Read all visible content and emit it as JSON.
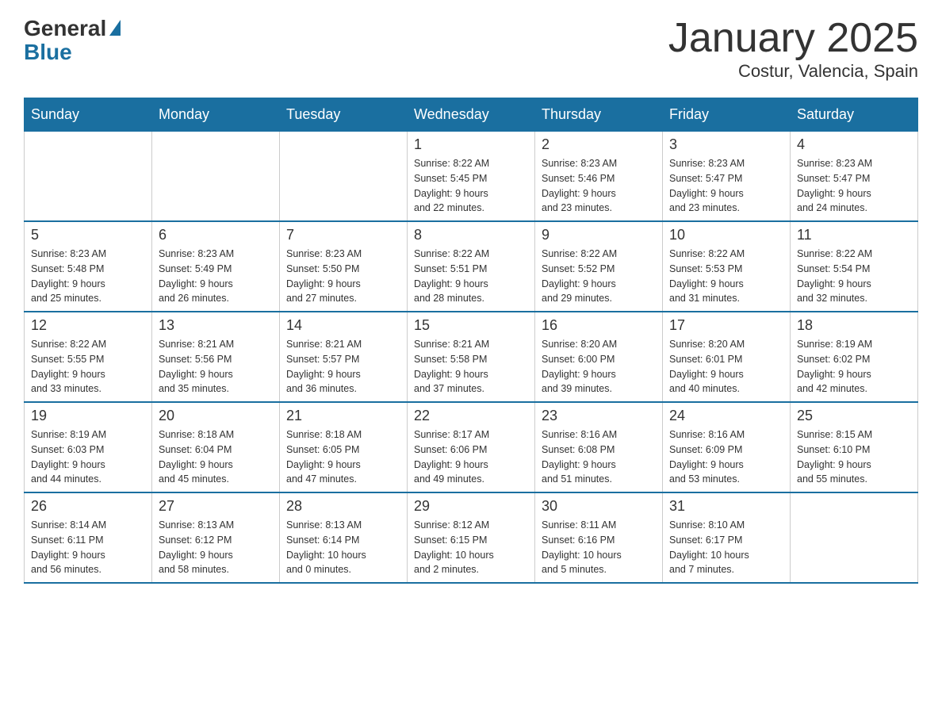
{
  "logo": {
    "general": "General",
    "blue": "Blue"
  },
  "title": "January 2025",
  "subtitle": "Costur, Valencia, Spain",
  "weekdays": [
    "Sunday",
    "Monday",
    "Tuesday",
    "Wednesday",
    "Thursday",
    "Friday",
    "Saturday"
  ],
  "weeks": [
    [
      {
        "day": "",
        "info": ""
      },
      {
        "day": "",
        "info": ""
      },
      {
        "day": "",
        "info": ""
      },
      {
        "day": "1",
        "info": "Sunrise: 8:22 AM\nSunset: 5:45 PM\nDaylight: 9 hours\nand 22 minutes."
      },
      {
        "day": "2",
        "info": "Sunrise: 8:23 AM\nSunset: 5:46 PM\nDaylight: 9 hours\nand 23 minutes."
      },
      {
        "day": "3",
        "info": "Sunrise: 8:23 AM\nSunset: 5:47 PM\nDaylight: 9 hours\nand 23 minutes."
      },
      {
        "day": "4",
        "info": "Sunrise: 8:23 AM\nSunset: 5:47 PM\nDaylight: 9 hours\nand 24 minutes."
      }
    ],
    [
      {
        "day": "5",
        "info": "Sunrise: 8:23 AM\nSunset: 5:48 PM\nDaylight: 9 hours\nand 25 minutes."
      },
      {
        "day": "6",
        "info": "Sunrise: 8:23 AM\nSunset: 5:49 PM\nDaylight: 9 hours\nand 26 minutes."
      },
      {
        "day": "7",
        "info": "Sunrise: 8:23 AM\nSunset: 5:50 PM\nDaylight: 9 hours\nand 27 minutes."
      },
      {
        "day": "8",
        "info": "Sunrise: 8:22 AM\nSunset: 5:51 PM\nDaylight: 9 hours\nand 28 minutes."
      },
      {
        "day": "9",
        "info": "Sunrise: 8:22 AM\nSunset: 5:52 PM\nDaylight: 9 hours\nand 29 minutes."
      },
      {
        "day": "10",
        "info": "Sunrise: 8:22 AM\nSunset: 5:53 PM\nDaylight: 9 hours\nand 31 minutes."
      },
      {
        "day": "11",
        "info": "Sunrise: 8:22 AM\nSunset: 5:54 PM\nDaylight: 9 hours\nand 32 minutes."
      }
    ],
    [
      {
        "day": "12",
        "info": "Sunrise: 8:22 AM\nSunset: 5:55 PM\nDaylight: 9 hours\nand 33 minutes."
      },
      {
        "day": "13",
        "info": "Sunrise: 8:21 AM\nSunset: 5:56 PM\nDaylight: 9 hours\nand 35 minutes."
      },
      {
        "day": "14",
        "info": "Sunrise: 8:21 AM\nSunset: 5:57 PM\nDaylight: 9 hours\nand 36 minutes."
      },
      {
        "day": "15",
        "info": "Sunrise: 8:21 AM\nSunset: 5:58 PM\nDaylight: 9 hours\nand 37 minutes."
      },
      {
        "day": "16",
        "info": "Sunrise: 8:20 AM\nSunset: 6:00 PM\nDaylight: 9 hours\nand 39 minutes."
      },
      {
        "day": "17",
        "info": "Sunrise: 8:20 AM\nSunset: 6:01 PM\nDaylight: 9 hours\nand 40 minutes."
      },
      {
        "day": "18",
        "info": "Sunrise: 8:19 AM\nSunset: 6:02 PM\nDaylight: 9 hours\nand 42 minutes."
      }
    ],
    [
      {
        "day": "19",
        "info": "Sunrise: 8:19 AM\nSunset: 6:03 PM\nDaylight: 9 hours\nand 44 minutes."
      },
      {
        "day": "20",
        "info": "Sunrise: 8:18 AM\nSunset: 6:04 PM\nDaylight: 9 hours\nand 45 minutes."
      },
      {
        "day": "21",
        "info": "Sunrise: 8:18 AM\nSunset: 6:05 PM\nDaylight: 9 hours\nand 47 minutes."
      },
      {
        "day": "22",
        "info": "Sunrise: 8:17 AM\nSunset: 6:06 PM\nDaylight: 9 hours\nand 49 minutes."
      },
      {
        "day": "23",
        "info": "Sunrise: 8:16 AM\nSunset: 6:08 PM\nDaylight: 9 hours\nand 51 minutes."
      },
      {
        "day": "24",
        "info": "Sunrise: 8:16 AM\nSunset: 6:09 PM\nDaylight: 9 hours\nand 53 minutes."
      },
      {
        "day": "25",
        "info": "Sunrise: 8:15 AM\nSunset: 6:10 PM\nDaylight: 9 hours\nand 55 minutes."
      }
    ],
    [
      {
        "day": "26",
        "info": "Sunrise: 8:14 AM\nSunset: 6:11 PM\nDaylight: 9 hours\nand 56 minutes."
      },
      {
        "day": "27",
        "info": "Sunrise: 8:13 AM\nSunset: 6:12 PM\nDaylight: 9 hours\nand 58 minutes."
      },
      {
        "day": "28",
        "info": "Sunrise: 8:13 AM\nSunset: 6:14 PM\nDaylight: 10 hours\nand 0 minutes."
      },
      {
        "day": "29",
        "info": "Sunrise: 8:12 AM\nSunset: 6:15 PM\nDaylight: 10 hours\nand 2 minutes."
      },
      {
        "day": "30",
        "info": "Sunrise: 8:11 AM\nSunset: 6:16 PM\nDaylight: 10 hours\nand 5 minutes."
      },
      {
        "day": "31",
        "info": "Sunrise: 8:10 AM\nSunset: 6:17 PM\nDaylight: 10 hours\nand 7 minutes."
      },
      {
        "day": "",
        "info": ""
      }
    ]
  ]
}
